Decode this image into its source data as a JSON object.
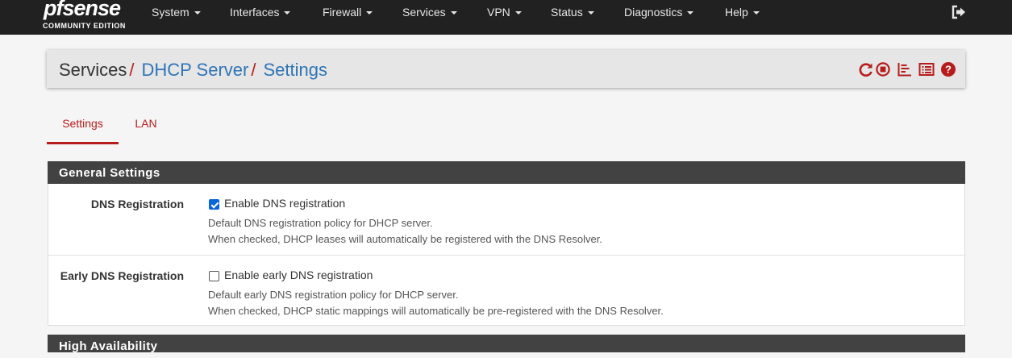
{
  "logo": {
    "brand": "pfsense",
    "edition": "COMMUNITY EDITION"
  },
  "nav": {
    "items": [
      {
        "label": "System"
      },
      {
        "label": "Interfaces"
      },
      {
        "label": "Firewall"
      },
      {
        "label": "Services"
      },
      {
        "label": "VPN"
      },
      {
        "label": "Status"
      },
      {
        "label": "Diagnostics"
      },
      {
        "label": "Help"
      }
    ],
    "logout_icon": "sign-out-icon"
  },
  "breadcrumb": {
    "root": "Services",
    "separator": "/",
    "level2": "DHCP Server",
    "level3": "Settings",
    "icons": [
      "reload-icon",
      "stop-circle-icon",
      "bar-chart-icon",
      "list-icon",
      "help-icon"
    ]
  },
  "tabs": [
    {
      "label": "Settings",
      "active": true
    },
    {
      "label": "LAN",
      "active": false
    }
  ],
  "general_settings": {
    "heading": "General Settings",
    "rows": [
      {
        "label": "DNS Registration",
        "checkbox_label": "Enable DNS registration",
        "checked": true,
        "help_line1": "Default DNS registration policy for DHCP server.",
        "help_line2": "When checked, DHCP leases will automatically be registered with the DNS Resolver."
      },
      {
        "label": "Early DNS Registration",
        "checkbox_label": "Enable early DNS registration",
        "checked": false,
        "help_line1": "Default early DNS registration policy for DHCP server.",
        "help_line2": "When checked, DHCP static mappings will automatically be pre-registered with the DNS Resolver."
      }
    ]
  },
  "high_availability": {
    "heading": "High Availability"
  },
  "colors": {
    "navbar": "#212121",
    "accent_red": "#b71c1c",
    "link_blue": "#2f74b6",
    "panel_heading": "#424242",
    "checkbox_blue": "#0a66d8"
  }
}
